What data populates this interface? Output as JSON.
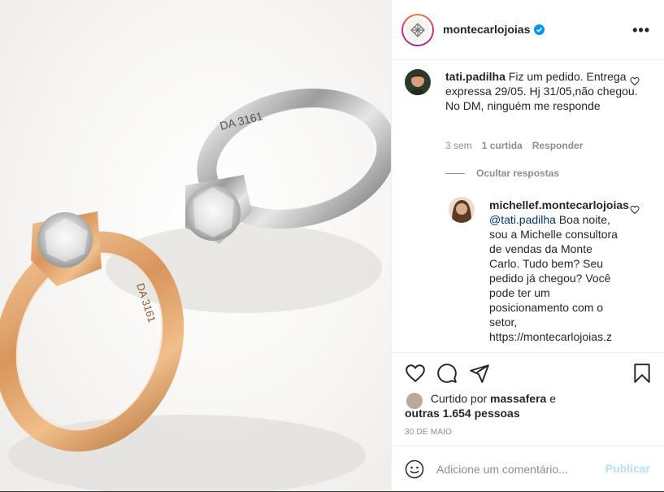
{
  "post": {
    "account": "montecarlojoias",
    "verified": true
  },
  "comments": [
    {
      "user": "tati.padilha",
      "text": "Fiz um pedido. Entrega expressa 29/05. Hj 31/05,não chegou. No DM, ninguém me responde",
      "time": "3 sem",
      "likes": "1 curtida",
      "reply": "Responder",
      "hide_replies": "Ocultar respostas"
    },
    {
      "user": "michellef.montecarlojoias",
      "mention": "@tati.padilha",
      "text": "Boa noite, sou a Michelle consultora de vendas da Monte Carlo. Tudo bem? Seu pedido já chegou? Você pode ter um posicionamento com o setor, https://montecarlojoias.z"
    }
  ],
  "likes": {
    "prefix": "Curtido por",
    "user": "massafera",
    "connector": "e",
    "others": "outras 1.654 pessoas"
  },
  "date": "30 DE MAIO",
  "composer": {
    "placeholder": "Adicione um comentário...",
    "publish_label": "Publicar"
  },
  "colors": {
    "accent": "#0095f6",
    "publish_disabled": "#b2dffc",
    "verified": "#0095f6"
  },
  "icons": [
    "heart-icon",
    "comment-icon",
    "share-icon",
    "bookmark-icon",
    "emoji-icon",
    "more-icon",
    "verified-icon"
  ]
}
